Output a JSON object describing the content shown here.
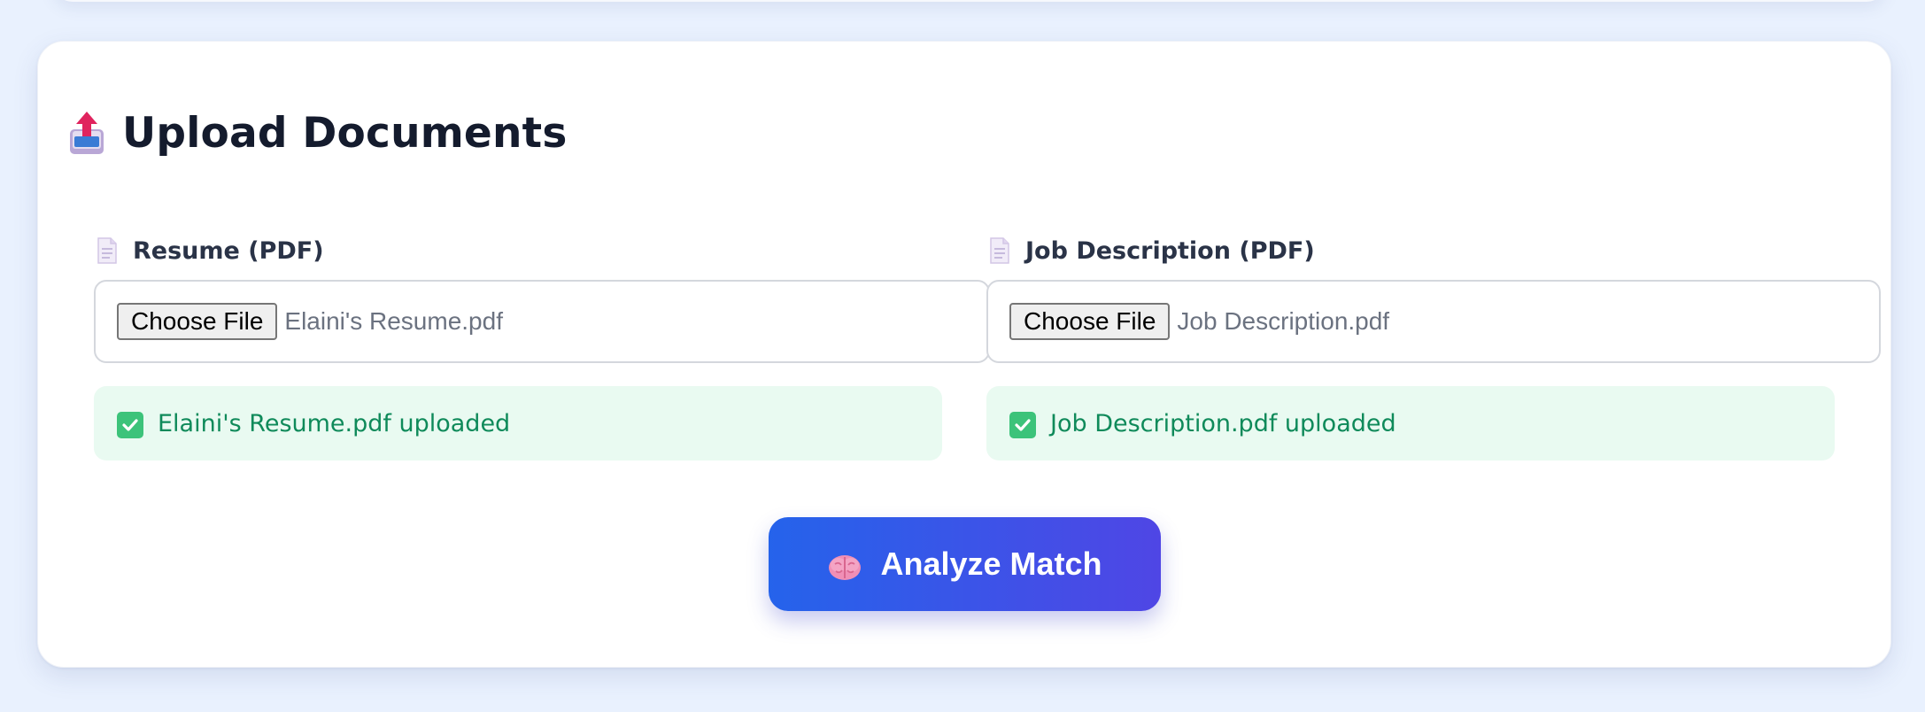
{
  "upload_section": {
    "title": "Upload Documents",
    "icon": "outbox-tray-icon"
  },
  "resume": {
    "label": "Resume (PDF)",
    "label_icon": "page-document-icon",
    "button_label": "Choose File",
    "file_name": "Elaini's Resume.pdf",
    "status_text": "Elaini's Resume.pdf uploaded",
    "status_icon": "check-mark-button-icon"
  },
  "job_description": {
    "label": "Job Description (PDF)",
    "label_icon": "page-document-icon",
    "button_label": "Choose File",
    "file_name": "Job Description.pdf",
    "status_text": "Job Description.pdf uploaded",
    "status_icon": "check-mark-button-icon"
  },
  "analyze_button": {
    "label": "Analyze Match",
    "icon": "brain-icon"
  },
  "colors": {
    "page_background": "#e9f1fe",
    "card_background": "#ffffff",
    "success_background": "#e9faf1",
    "success_text": "#0f8a5a",
    "button_gradient_start": "#2563eb",
    "button_gradient_end": "#4f46e5"
  }
}
